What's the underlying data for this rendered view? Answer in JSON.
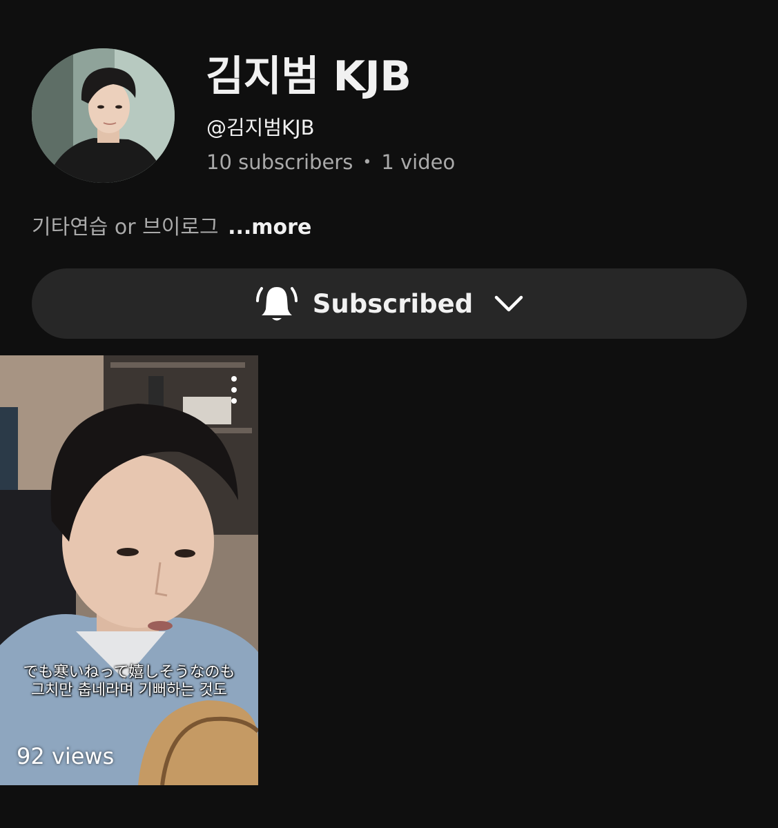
{
  "channel": {
    "name": "김지범 KJB",
    "handle": "@김지범KJB",
    "subscribers": "10 subscribers",
    "separator": "•",
    "videos": "1 video",
    "description": "기타연습 or 브이로그",
    "more_label": "...more"
  },
  "subscribe_button": {
    "label": "Subscribed",
    "icon": "bell-icon",
    "dropdown_icon": "chevron-down-icon"
  },
  "videos": [
    {
      "caption_line1": "でも寒いねって嬉しそうなのも",
      "caption_line2": "그치만 춥네라며 기뻐하는 것도",
      "views": "92 views"
    }
  ],
  "colors": {
    "background": "#0f0f0f",
    "button_bg": "#272727",
    "primary_text": "#f1f1f1",
    "secondary_text": "#aaaaaa"
  }
}
